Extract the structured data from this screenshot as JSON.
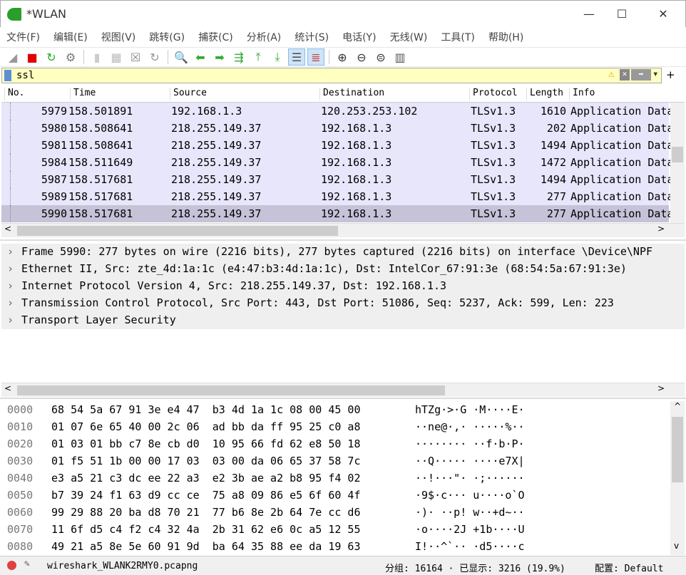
{
  "window": {
    "title": "*WLAN",
    "minimize": "—",
    "maximize": "☐",
    "close": "✕"
  },
  "menu": [
    "文件(F)",
    "编辑(E)",
    "视图(V)",
    "跳转(G)",
    "捕获(C)",
    "分析(A)",
    "统计(S)",
    "电话(Y)",
    "无线(W)",
    "工具(T)",
    "帮助(H)"
  ],
  "toolbar": [
    {
      "icon": "shark-fin-start-icon",
      "glyph": "◢",
      "color": "#999"
    },
    {
      "icon": "stop-capture-icon",
      "glyph": "■",
      "color": "#e00000"
    },
    {
      "icon": "restart-capture-icon",
      "glyph": "↻",
      "color": "#22aa22"
    },
    {
      "icon": "capture-options-icon",
      "glyph": "⚙",
      "color": "#777"
    },
    {
      "sep": true
    },
    {
      "icon": "open-file-icon",
      "glyph": "▮",
      "color": "#ccc"
    },
    {
      "icon": "save-file-icon",
      "glyph": "▦",
      "color": "#bbb"
    },
    {
      "icon": "close-file-icon",
      "glyph": "☒",
      "color": "#888"
    },
    {
      "icon": "reload-file-icon",
      "glyph": "↻",
      "color": "#999"
    },
    {
      "sep": true
    },
    {
      "icon": "find-packet-icon",
      "glyph": "🔍",
      "color": "#333"
    },
    {
      "icon": "go-back-icon",
      "glyph": "⬅",
      "color": "#3a3"
    },
    {
      "icon": "go-forward-icon",
      "glyph": "➡",
      "color": "#3a3"
    },
    {
      "icon": "go-to-packet-icon",
      "glyph": "⇶",
      "color": "#3a3"
    },
    {
      "icon": "first-packet-icon",
      "glyph": "⤒",
      "color": "#3a3"
    },
    {
      "icon": "last-packet-icon",
      "glyph": "⤓",
      "color": "#3a3"
    },
    {
      "icon": "autoscroll-icon",
      "glyph": "☰",
      "color": "#555",
      "active": true
    },
    {
      "icon": "colorize-icon",
      "glyph": "≣",
      "color": "#c44",
      "active": true
    },
    {
      "sep": true
    },
    {
      "icon": "zoom-in-icon",
      "glyph": "⊕",
      "color": "#333"
    },
    {
      "icon": "zoom-out-icon",
      "glyph": "⊖",
      "color": "#333"
    },
    {
      "icon": "zoom-reset-icon",
      "glyph": "⊜",
      "color": "#333"
    },
    {
      "icon": "resize-columns-icon",
      "glyph": "▥",
      "color": "#555"
    }
  ],
  "filter": {
    "value": "ssl",
    "warning": "⚠",
    "clear": "✕",
    "apply": "➡",
    "dropdown": "▾",
    "add": "+"
  },
  "packet_list": {
    "columns": [
      "No.",
      "Time",
      "Source",
      "Destination",
      "Protocol",
      "Length",
      "Info"
    ],
    "rows": [
      [
        "5979",
        "158.501891",
        "192.168.1.3",
        "120.253.253.102",
        "TLSv1.3",
        "1610",
        "Application Data"
      ],
      [
        "5980",
        "158.508641",
        "218.255.149.37",
        "192.168.1.3",
        "TLSv1.3",
        "202",
        "Application Data"
      ],
      [
        "5981",
        "158.508641",
        "218.255.149.37",
        "192.168.1.3",
        "TLSv1.3",
        "1494",
        "Application Data"
      ],
      [
        "5984",
        "158.511649",
        "218.255.149.37",
        "192.168.1.3",
        "TLSv1.3",
        "1472",
        "Application Data"
      ],
      [
        "5987",
        "158.517681",
        "218.255.149.37",
        "192.168.1.3",
        "TLSv1.3",
        "1494",
        "Application Data"
      ],
      [
        "5989",
        "158.517681",
        "218.255.149.37",
        "192.168.1.3",
        "TLSv1.3",
        "277",
        "Application Data"
      ],
      [
        "5990",
        "158.517681",
        "218.255.149.37",
        "192.168.1.3",
        "TLSv1.3",
        "277",
        "Application Data"
      ]
    ],
    "selected_index": 6
  },
  "details": [
    "Frame 5990: 277 bytes on wire (2216 bits), 277 bytes captured (2216 bits) on interface \\Device\\NPF",
    "Ethernet II, Src: zte_4d:1a:1c (e4:47:b3:4d:1a:1c), Dst: IntelCor_67:91:3e (68:54:5a:67:91:3e)",
    "Internet Protocol Version 4, Src: 218.255.149.37, Dst: 192.168.1.3",
    "Transmission Control Protocol, Src Port: 443, Dst Port: 51086, Seq: 5237, Ack: 599, Len: 223",
    "Transport Layer Security"
  ],
  "bytes": [
    {
      "offset": "0000",
      "hex": "68 54 5a 67 91 3e e4 47  b3 4d 1a 1c 08 00 45 00",
      "ascii": "hTZg·>·G ·M····E·"
    },
    {
      "offset": "0010",
      "hex": "01 07 6e 65 40 00 2c 06  ad bb da ff 95 25 c0 a8",
      "ascii": "··ne@·,· ·····%··"
    },
    {
      "offset": "0020",
      "hex": "01 03 01 bb c7 8e cb d0  10 95 66 fd 62 e8 50 18",
      "ascii": "········ ··f·b·P·"
    },
    {
      "offset": "0030",
      "hex": "01 f5 51 1b 00 00 17 03  03 00 da 06 65 37 58 7c",
      "ascii": "··Q····· ····e7X|"
    },
    {
      "offset": "0040",
      "hex": "e3 a5 21 c3 dc ee 22 a3  e2 3b ae a2 b8 95 f4 02",
      "ascii": "··!···\"· ·;······"
    },
    {
      "offset": "0050",
      "hex": "b7 39 24 f1 63 d9 cc ce  75 a8 09 86 e5 6f 60 4f",
      "ascii": "·9$·c··· u····o`O"
    },
    {
      "offset": "0060",
      "hex": "99 29 88 20 ba d8 70 21  77 b6 8e 2b 64 7e cc d6",
      "ascii": "·)· ··p! w··+d~··"
    },
    {
      "offset": "0070",
      "hex": "11 6f d5 c4 f2 c4 32 4a  2b 31 62 e6 0c a5 12 55",
      "ascii": "·o····2J +1b····U"
    },
    {
      "offset": "0080",
      "hex": "49 21 a5 8e 5e 60 91 9d  ba 64 35 88 ee da 19 63",
      "ascii": "I!··^`·· ·d5····c"
    }
  ],
  "status": {
    "file": "wireshark_WLANK2RMY0.pcapng",
    "packets": "分组: 16164 · 已显示: 3216 (19.9%)",
    "profile": "配置: Default"
  }
}
